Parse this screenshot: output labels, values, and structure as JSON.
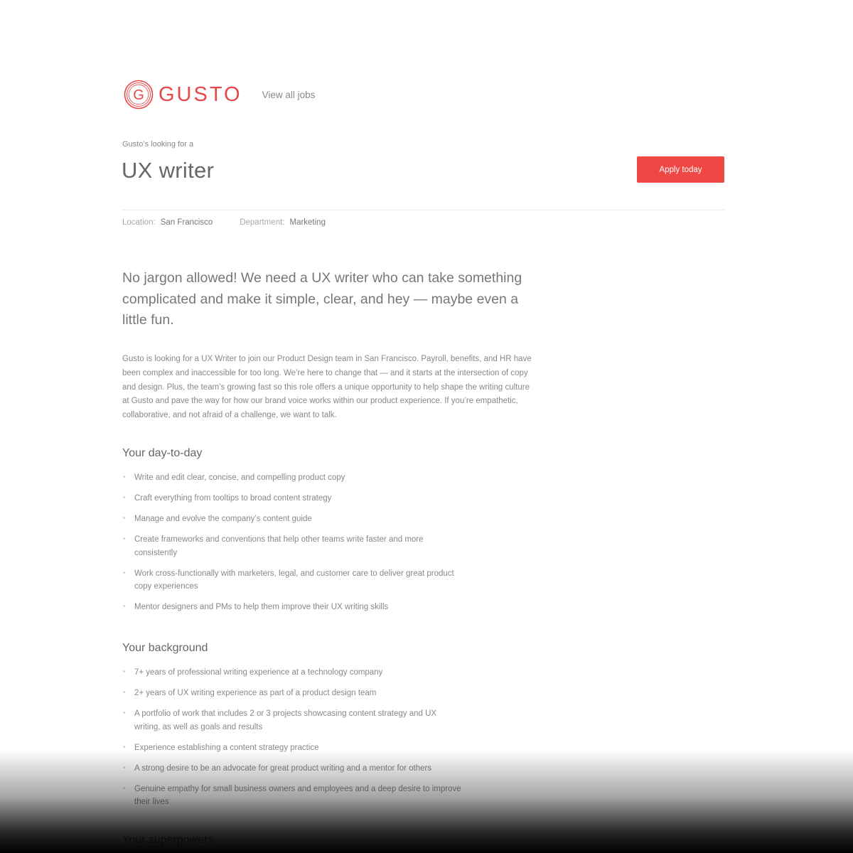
{
  "brand": {
    "name": "GUSTO",
    "letter": "G",
    "accent": "#e8474a"
  },
  "nav": {
    "view_all_jobs": "View all jobs"
  },
  "job": {
    "eyebrow": "Gusto’s looking for a",
    "title": "UX writer",
    "apply_label": "Apply today",
    "location_label": "Location:",
    "location": "San Francisco",
    "department_label": "Department:",
    "department": "Marketing"
  },
  "content": {
    "lede": "No jargon allowed! We need a UX writer who can take something complicated and make it simple, clear, and hey — maybe even a little fun.",
    "intro": "Gusto is looking for a UX Writer to join our Product Design team in San Francisco. Payroll, benefits, and HR have been complex and inaccessible for too long. We’re here to change that — and it starts at the intersection of copy and design. Plus, the team’s growing fast so this role offers a unique opportunity to help shape the writing culture at Gusto and pave the way for how our brand voice works within our product experience. If you’re empathetic, collaborative, and not afraid of a challenge, we want to talk.",
    "day_to_day": {
      "title": "Your day-to-day",
      "items": [
        "Write and edit clear, concise, and compelling product copy",
        "Craft everything from tooltips to broad content strategy",
        "Manage and evolve the company’s content guide",
        "Create frameworks and conventions that help other teams write faster and more consistently",
        "Work cross-functionally with marketers, legal, and customer care to deliver great product copy experiences",
        "Mentor designers and PMs to help them improve their UX writing skills"
      ]
    },
    "background": {
      "title": "Your background",
      "items": [
        "7+ years of professional writing experience at a technology company",
        "2+ years of UX writing experience as part of a product design team",
        "A portfolio of work that includes 2 or 3 projects showcasing content strategy and UX writing, as well as goals and results",
        "Experience establishing a content strategy practice",
        "A strong desire to be an advocate for great product writing and a mentor for others",
        "Genuine empathy for small business owners and employees and a deep desire to improve their lives"
      ]
    },
    "next_section_title": "Your superpowers"
  }
}
